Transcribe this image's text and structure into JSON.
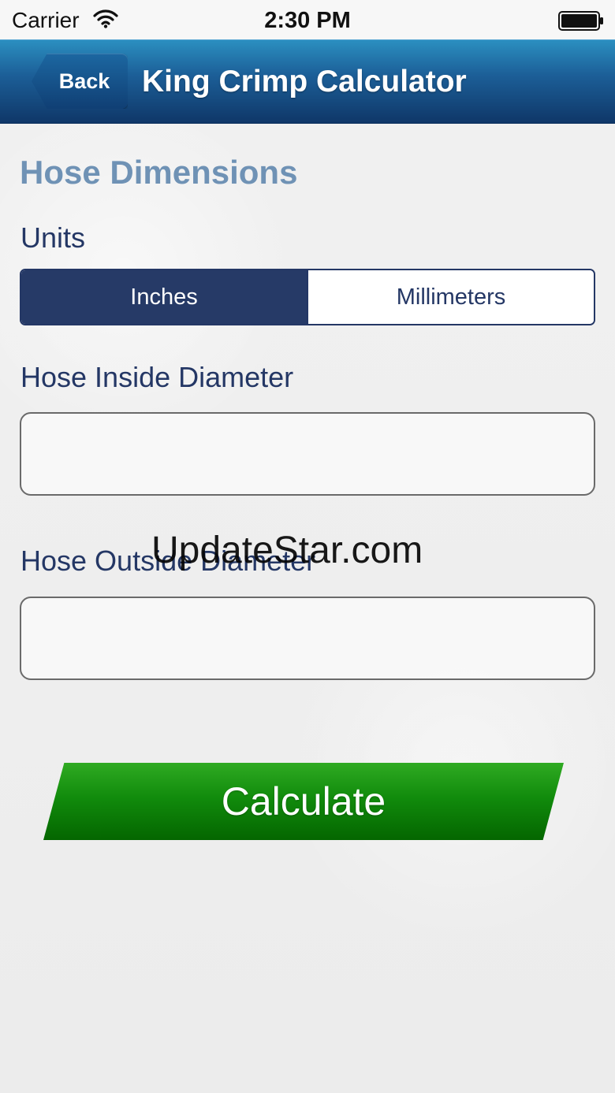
{
  "status_bar": {
    "carrier": "Carrier",
    "time": "2:30 PM",
    "icons": [
      "wifi-icon",
      "battery-icon"
    ]
  },
  "nav": {
    "back_label": "Back",
    "title": "King Crimp Calculator"
  },
  "section": {
    "title": "Hose Dimensions"
  },
  "units": {
    "label": "Units",
    "options": [
      "Inches",
      "Millimeters"
    ],
    "selected": "Inches"
  },
  "inside_diameter": {
    "label": "Hose Inside Diameter",
    "value": ""
  },
  "outside_diameter": {
    "label": "Hose Outside Diameter",
    "value": ""
  },
  "calculate_label": "Calculate",
  "watermark": "UpdateStar.com",
  "colors": {
    "nav_blue": "#1c5f98",
    "label_navy": "#243765",
    "section_title": "#6f92b5",
    "calculate_green": "#118b0c"
  }
}
